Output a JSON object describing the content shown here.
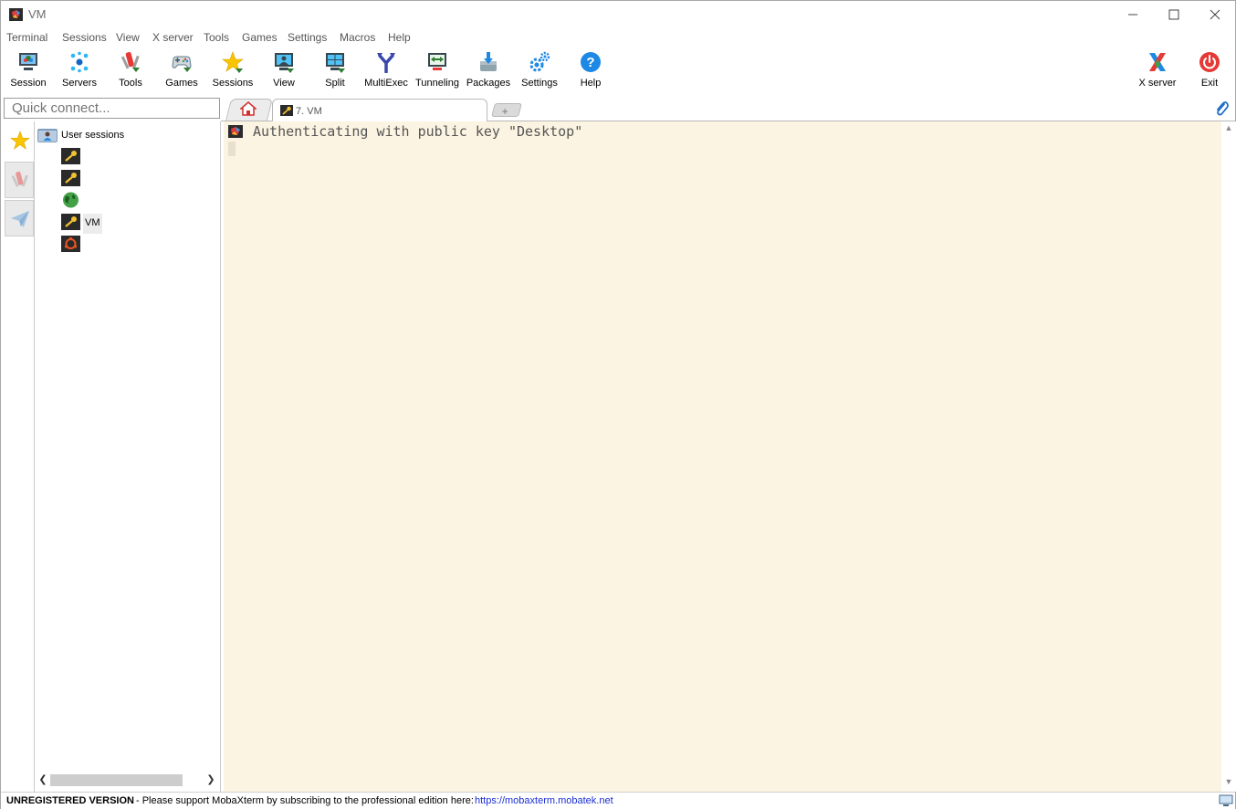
{
  "window": {
    "title": "VM"
  },
  "menu": [
    "Terminal",
    "Sessions",
    "View",
    "X server",
    "Tools",
    "Games",
    "Settings",
    "Macros",
    "Help"
  ],
  "toolbar": {
    "left": [
      {
        "label": "Session",
        "icon": "session-icon"
      },
      {
        "label": "Servers",
        "icon": "servers-icon"
      },
      {
        "label": "Tools",
        "icon": "tools-icon"
      },
      {
        "label": "Games",
        "icon": "games-icon"
      },
      {
        "label": "Sessions",
        "icon": "star-icon"
      },
      {
        "label": "View",
        "icon": "view-icon"
      },
      {
        "label": "Split",
        "icon": "split-icon"
      },
      {
        "label": "MultiExec",
        "icon": "multiexec-icon"
      },
      {
        "label": "Tunneling",
        "icon": "tunneling-icon"
      },
      {
        "label": "Packages",
        "icon": "packages-icon"
      },
      {
        "label": "Settings",
        "icon": "gears-icon"
      },
      {
        "label": "Help",
        "icon": "help-icon"
      }
    ],
    "right": [
      {
        "label": "X server",
        "icon": "xserver-icon"
      },
      {
        "label": "Exit",
        "icon": "power-icon"
      }
    ]
  },
  "quick_connect": {
    "placeholder": "Quick connect..."
  },
  "tabs": [
    {
      "label": "7. VM",
      "icon": "ssh-key-icon",
      "active": true
    }
  ],
  "sessions": {
    "root_label": "User sessions",
    "items": [
      {
        "label": "",
        "icon": "ssh-key-icon"
      },
      {
        "label": "",
        "icon": "ssh-key-icon"
      },
      {
        "label": "",
        "icon": "globe-icon"
      },
      {
        "label": "VM",
        "icon": "ssh-key-icon"
      },
      {
        "label": "",
        "icon": "ubuntu-icon"
      }
    ]
  },
  "terminal": {
    "lines": [
      "Authenticating with public key \"Desktop\""
    ],
    "background": "#fcf4e2"
  },
  "status": {
    "bold": "UNREGISTERED VERSION",
    "text": "-  Please support MobaXterm by subscribing to the professional edition here:",
    "link": "https://mobaxterm.mobatek.net"
  }
}
